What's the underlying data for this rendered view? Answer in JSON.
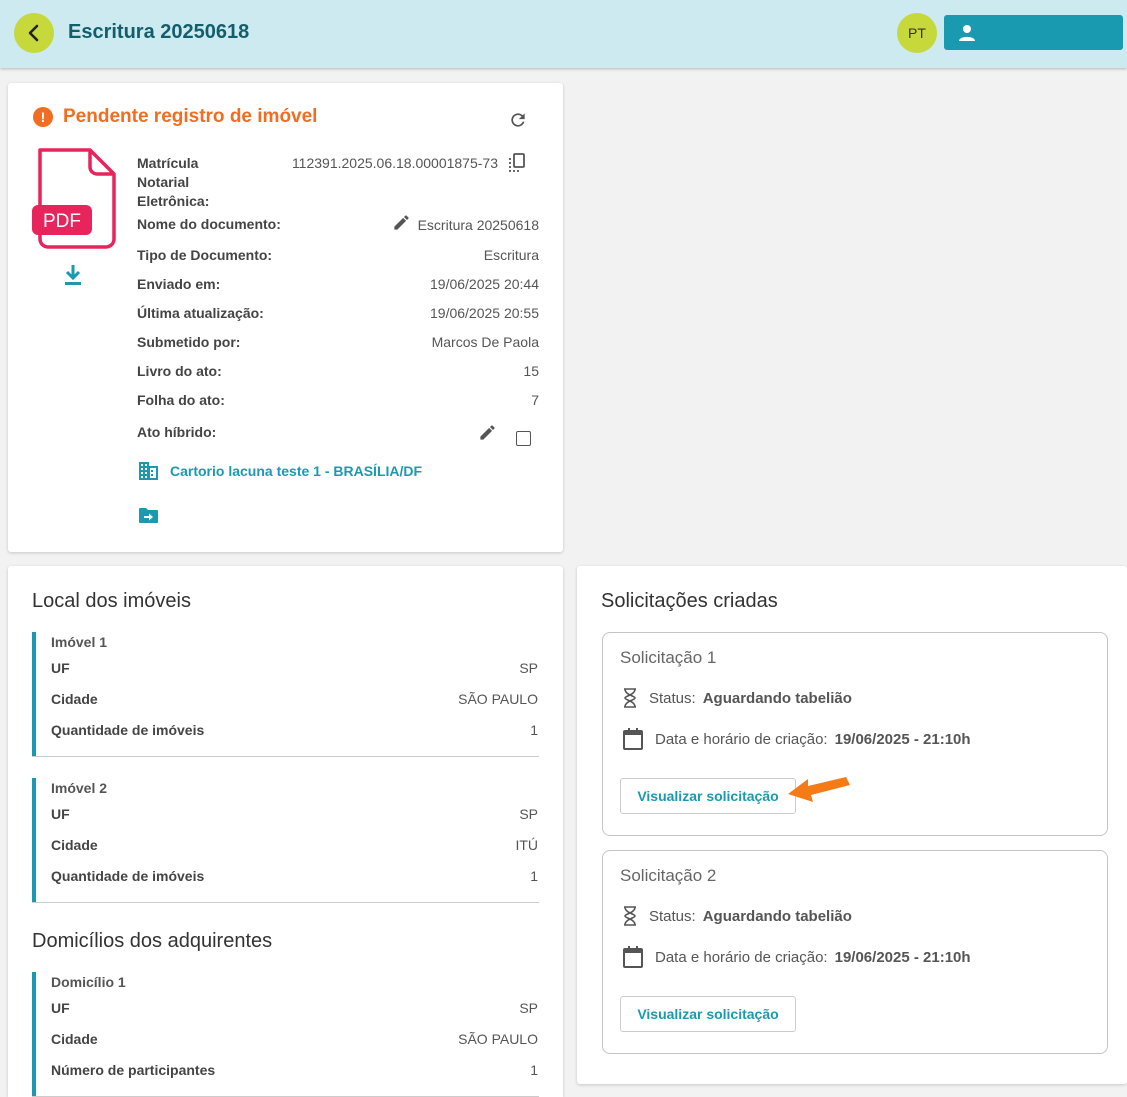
{
  "header": {
    "title": "Escritura 20250618",
    "avatar_initials": "PT",
    "user_button_label": ""
  },
  "document": {
    "status": "Pendente registro de imóvel",
    "pdf_label": "PDF",
    "fields": [
      {
        "label": "Matrícula Notarial Eletrônica:",
        "value": "112391.2025.06.18.00001875-73"
      },
      {
        "label": "Nome do documento:",
        "value": "Escritura 20250618"
      },
      {
        "label": "Tipo de Documento:",
        "value": "Escritura"
      },
      {
        "label": "Enviado em:",
        "value": "19/06/2025 20:44"
      },
      {
        "label": "Última atualização:",
        "value": "19/06/2025 20:55"
      },
      {
        "label": "Submetido por:",
        "value": "Marcos De Paola"
      },
      {
        "label": "Livro do ato:",
        "value": "15"
      },
      {
        "label": "Folha do ato:",
        "value": "7"
      },
      {
        "label": "Ato híbrido:",
        "value": ""
      }
    ],
    "matricula_label_lines": [
      "Matrícula",
      "Notarial",
      "Eletrônica:"
    ],
    "office": "Cartorio lacuna teste 1 - BRASÍLIA/DF",
    "hybrid_checked": false
  },
  "locations": {
    "title": "Local dos imóveis",
    "items": [
      {
        "title": "Imóvel 1",
        "uf_label": "UF",
        "uf": "SP",
        "city_label": "Cidade",
        "city": "SÃO PAULO",
        "count_label": "Quantidade de imóveis",
        "count": "1"
      },
      {
        "title": "Imóvel 2",
        "uf_label": "UF",
        "uf": "SP",
        "city_label": "Cidade",
        "city": "ITÚ",
        "count_label": "Quantidade de imóveis",
        "count": "1"
      }
    ]
  },
  "domiciles": {
    "title": "Domicílios dos adquirentes",
    "items": [
      {
        "title": "Domicílio 1",
        "uf_label": "UF",
        "uf": "SP",
        "city_label": "Cidade",
        "city": "SÃO PAULO",
        "count_label": "Número de participantes",
        "count": "1"
      }
    ]
  },
  "requests": {
    "title": "Solicitações criadas",
    "items": [
      {
        "title": "Solicitação 1",
        "status_label": "Status:",
        "status": "Aguardando tabelião",
        "date_label": "Data e horário de criação:",
        "date": "19/06/2025 - 21:10h",
        "button": "Visualizar solicitação"
      },
      {
        "title": "Solicitação 2",
        "status_label": "Status:",
        "status": "Aguardando tabelião",
        "date_label": "Data e horário de criação:",
        "date": "19/06/2025 - 21:10h",
        "button": "Visualizar solicitação"
      }
    ]
  },
  "colors": {
    "accent": "#1a9ab1",
    "header_bg": "#cdeaf0",
    "status_orange": "#f26d21",
    "pdf_red": "#e8245c",
    "lime": "#c7d83a"
  },
  "icons": [
    "back-icon",
    "user-icon",
    "alert-icon",
    "refresh-icon",
    "pdf-file-icon",
    "download-icon",
    "copy-icon",
    "edit-icon",
    "building-icon",
    "folder-move-icon",
    "hourglass-icon",
    "calendar-icon",
    "arrow-pointer-icon"
  ]
}
